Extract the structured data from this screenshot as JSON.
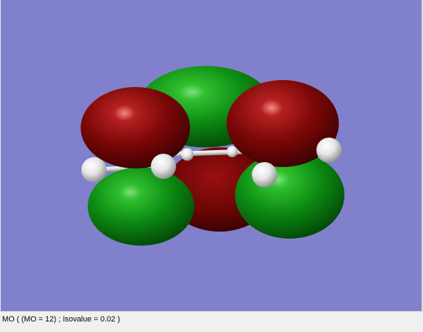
{
  "viewport": {
    "background_color": "#8080cc",
    "lobe_colors": {
      "positive": "#0c8a12",
      "negative": "#8a0a0a"
    },
    "atom_color": "#e8e8e8"
  },
  "status_bar": {
    "text": "MO ( (MO = 12) ; Isovalue = 0.02 )"
  }
}
